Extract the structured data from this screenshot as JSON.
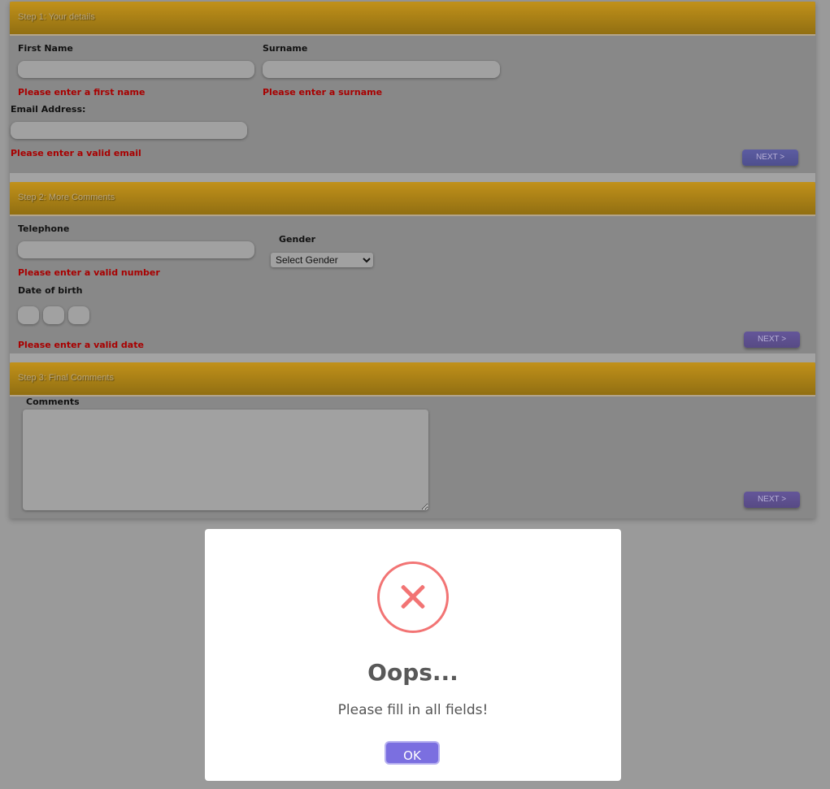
{
  "step1": {
    "header": "Step 1: Your details",
    "first_name_label": "First Name",
    "first_name_value": "",
    "first_name_error": "Please enter a first name",
    "surname_label": "Surname",
    "surname_value": "",
    "surname_error": "Please enter a surname",
    "email_label": "Email Address:",
    "email_value": "",
    "email_error": "Please enter a valid email",
    "next_label": "NEXT >"
  },
  "step2": {
    "header": "Step 2: More Comments",
    "telephone_label": "Telephone",
    "telephone_value": "",
    "telephone_error": "Please enter a valid number",
    "gender_label": "Gender",
    "gender_selected": "Select Gender",
    "dob_label": "Date of birth",
    "dob_error": "Please enter a valid date",
    "next_label": "NEXT >"
  },
  "step3": {
    "header": "Step 3: Final Comments",
    "comments_label": "Comments",
    "comments_value": "",
    "next_label": "NEXT >"
  },
  "modal": {
    "icon": "error-x-icon",
    "title": "Oops...",
    "text": "Please fill in all fields!",
    "ok_label": "OK"
  },
  "colors": {
    "header_gradient": "#c1911a",
    "error": "#a80000",
    "modal_error_icon": "#f27474",
    "ok_button": "#7b6fe0",
    "overlay": "#9a9a9a"
  }
}
